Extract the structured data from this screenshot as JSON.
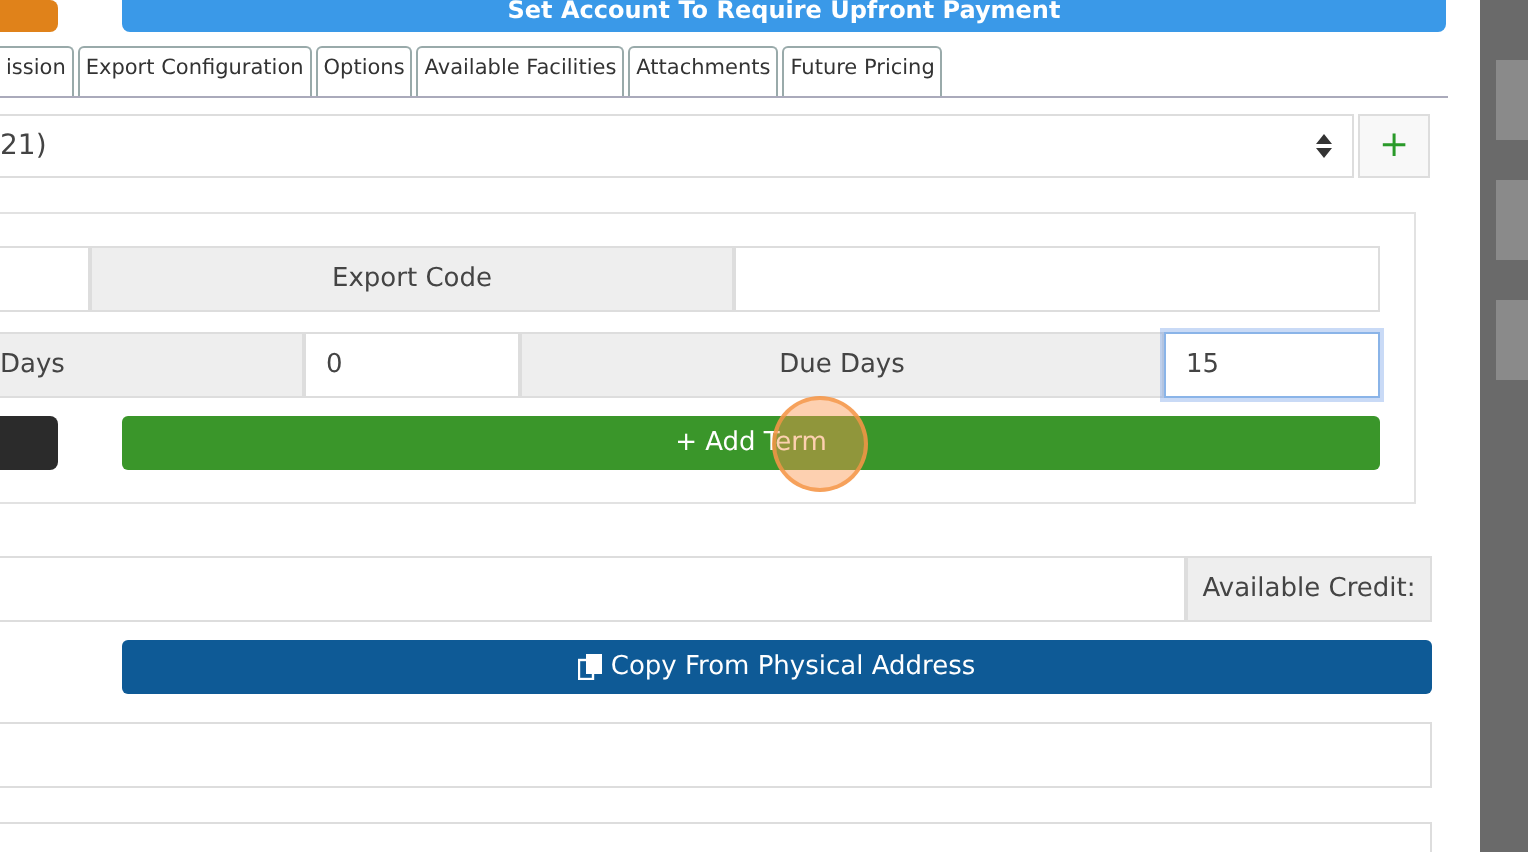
{
  "upfront_button": {
    "label": "Set Account To Require Upfront Payment"
  },
  "tabs": [
    {
      "label": "ission",
      "selected": false
    },
    {
      "label": "Export Configuration",
      "selected": false
    },
    {
      "label": "Options",
      "selected": false
    },
    {
      "label": "Available Facilities",
      "selected": false
    },
    {
      "label": "Attachments",
      "selected": false
    },
    {
      "label": "Future Pricing",
      "selected": false
    }
  ],
  "account_select": {
    "value": "21)",
    "add_icon": "+"
  },
  "terms_panel": {
    "export_code_label": "Export Code",
    "days_label": "Days",
    "days_value": "0",
    "due_days_label": "Due Days",
    "due_days_value": "15",
    "due_days_focused": true,
    "add_button": {
      "icon": "+",
      "label": "Add Term"
    }
  },
  "credit": {
    "label": "Available Credit:"
  },
  "copy_button": {
    "label": "Copy From Physical Address"
  }
}
